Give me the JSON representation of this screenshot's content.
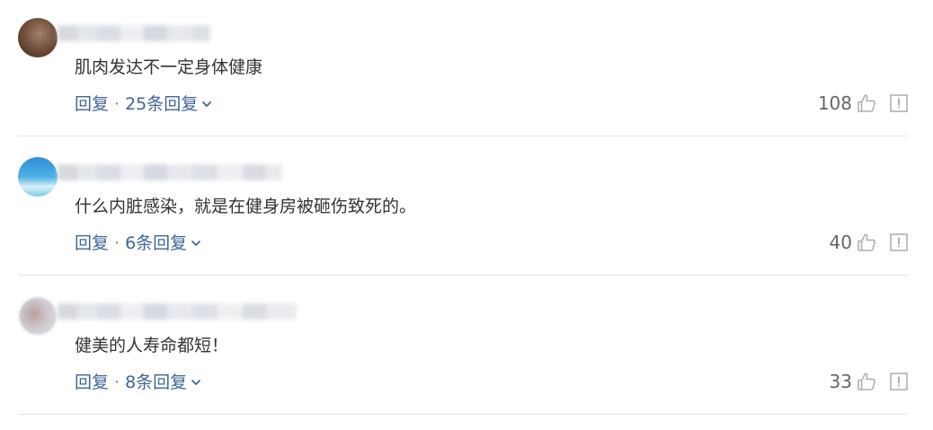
{
  "comments": [
    {
      "avatar": "user-avatar-brown",
      "text": "肌肉发达不一定身体健康",
      "reply_label": "回复",
      "separator": "·",
      "replies_label": "25条回复",
      "likes": "108"
    },
    {
      "avatar": "user-avatar-blue",
      "text": "什么内脏感染，就是在健身房被砸伤致死的。",
      "reply_label": "回复",
      "separator": "·",
      "replies_label": "6条回复",
      "likes": "40"
    },
    {
      "avatar": "user-avatar-grey",
      "text": "健美的人寿命都短！",
      "reply_label": "回复",
      "separator": "·",
      "replies_label": "8条回复",
      "likes": "33"
    }
  ],
  "icons": {
    "like": "thumbs-up-icon",
    "report": "report-icon",
    "expand": "chevron-down-icon"
  },
  "colors": {
    "link": "#406599",
    "text": "#333333",
    "muted": "#666666",
    "icon": "#b0b0b0",
    "divider": "#e5e5e5"
  }
}
